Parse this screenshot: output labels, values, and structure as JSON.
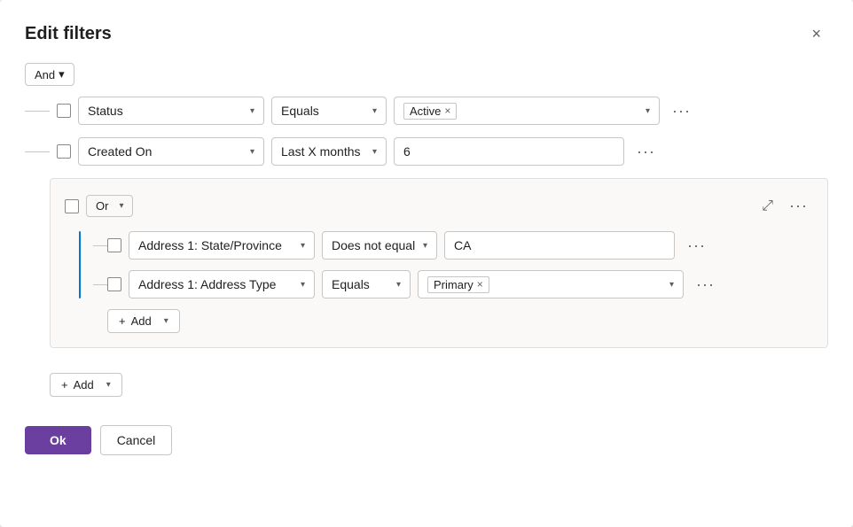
{
  "dialog": {
    "title": "Edit filters",
    "close_label": "×"
  },
  "and_btn": {
    "label": "And",
    "chevron": "▾"
  },
  "filter_rows": [
    {
      "id": "status-row",
      "field": "Status",
      "operator": "Equals",
      "value_tag": "Active",
      "value_type": "tag"
    },
    {
      "id": "created-on-row",
      "field": "Created On",
      "operator": "Last X months",
      "value": "6",
      "value_type": "text"
    }
  ],
  "or_group": {
    "label": "Or",
    "chevron": "▾",
    "inner_rows": [
      {
        "id": "state-row",
        "field": "Address 1: State/Province",
        "operator": "Does not equal",
        "value": "CA",
        "value_type": "text"
      },
      {
        "id": "address-type-row",
        "field": "Address 1: Address Type",
        "operator": "Equals",
        "value_tag": "Primary",
        "value_type": "tag"
      }
    ],
    "add_btn": "+ Add",
    "add_chevron": "▾"
  },
  "main_add_btn": "+ Add",
  "main_add_chevron": "▾",
  "footer": {
    "ok_label": "Ok",
    "cancel_label": "Cancel"
  },
  "more_icon": "···",
  "collapse_icon": "⤢"
}
